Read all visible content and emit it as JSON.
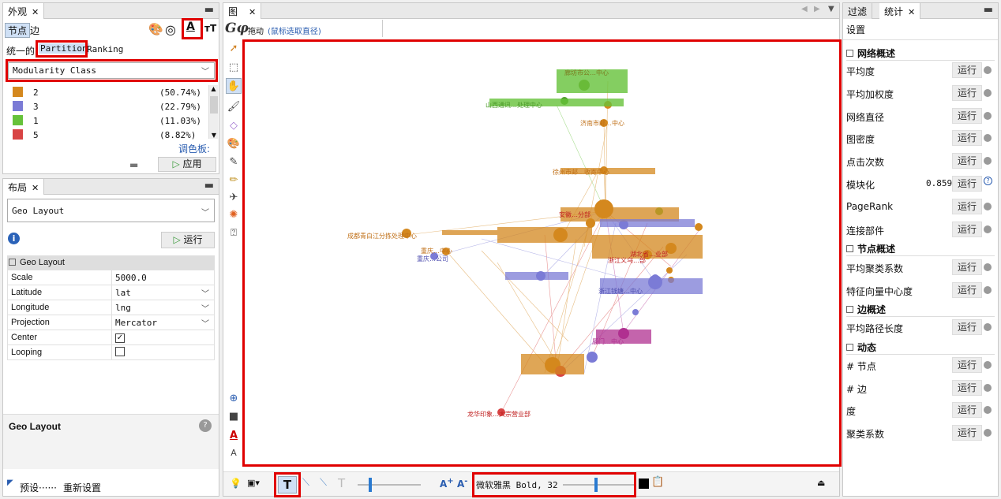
{
  "appearance": {
    "tab_title": "外观",
    "tabs": [
      "节点",
      "边"
    ],
    "mode_prefix": "统一的",
    "mode_partition": "Partition",
    "mode_ranking": "Ranking",
    "attribute": "Modularity Class",
    "legend": [
      {
        "label": "2",
        "pct": "(50.74%)",
        "color": "#d4881e"
      },
      {
        "label": "3",
        "pct": "(22.79%)",
        "color": "#7b7bd6"
      },
      {
        "label": "1",
        "pct": "(11.03%)",
        "color": "#66c23a"
      },
      {
        "label": "5",
        "pct": "(8.82%)",
        "color": "#d84444"
      }
    ],
    "palette_label": "调色板:",
    "apply_label": "应用"
  },
  "layout": {
    "tab_title": "布局",
    "algorithm": "Geo Layout",
    "run_label": "运行",
    "group_title": "Geo Layout",
    "props": [
      {
        "name": "Scale",
        "value": "5000.0",
        "type": "text"
      },
      {
        "name": "Latitude",
        "value": "lat",
        "type": "select"
      },
      {
        "name": "Longitude",
        "value": "lng",
        "type": "select"
      },
      {
        "name": "Projection",
        "value": "Mercator",
        "type": "select"
      },
      {
        "name": "Center",
        "value": "",
        "type": "checked"
      },
      {
        "name": "Looping",
        "value": "",
        "type": "unchecked"
      }
    ],
    "desc_title": "Geo Layout",
    "preset_label": "预设······",
    "reset_label": "重新设置"
  },
  "graph": {
    "tab_title": "图",
    "mode_label": "拖动",
    "mode_hint": "(鼠标选取直径)",
    "labels": [
      {
        "t": "廊坊市公…中心",
        "c": "#7b7b20"
      },
      {
        "t": "山西通讯…处理中心",
        "c": "#4c9a2a"
      },
      {
        "t": "济南市邮…中心",
        "c": "#c07018"
      },
      {
        "t": "徐州市邮…收寄中心",
        "c": "#c07018"
      },
      {
        "t": "成都青白江分拣处理中心",
        "c": "#c07018"
      },
      {
        "t": "安徽…分部",
        "c": "#c02020"
      },
      {
        "t": "湖北省…业部",
        "c": "#c02020"
      },
      {
        "t": "浙江义乌…部",
        "c": "#c02020"
      },
      {
        "t": "重庆…中心",
        "c": "#c07018"
      },
      {
        "t": "重庆…公司",
        "c": "#5050b0"
      },
      {
        "t": "浙江钱塘…中心",
        "c": "#5050b0"
      },
      {
        "t": "厦门…中心",
        "c": "#b03090"
      },
      {
        "t": "龙华印象…大宗营业部",
        "c": "#c02020"
      }
    ],
    "font_display": "微软雅黑 Bold, 32"
  },
  "stats": {
    "tabs": [
      "过滤",
      "统计"
    ],
    "settings_label": "设置",
    "run_label": "运行",
    "sections": [
      {
        "title": "网络概述",
        "items": [
          {
            "name": "平均度",
            "value": ""
          },
          {
            "name": "平均加权度",
            "value": ""
          },
          {
            "name": "网络直径",
            "value": ""
          },
          {
            "name": "图密度",
            "value": ""
          },
          {
            "name": "点击次数",
            "value": ""
          },
          {
            "name": "模块化",
            "value": "0.859"
          },
          {
            "name": "PageRank",
            "value": ""
          },
          {
            "name": "连接部件",
            "value": ""
          }
        ]
      },
      {
        "title": "节点概述",
        "items": [
          {
            "name": "平均聚类系数",
            "value": ""
          },
          {
            "name": "特征向量中心度",
            "value": ""
          }
        ]
      },
      {
        "title": "边概述",
        "items": [
          {
            "name": "平均路径长度",
            "value": ""
          }
        ]
      },
      {
        "title": "动态",
        "items": [
          {
            "name": "# 节点",
            "value": ""
          },
          {
            "name": "# 边",
            "value": ""
          },
          {
            "name": "度",
            "value": ""
          },
          {
            "name": "聚类系数",
            "value": ""
          }
        ]
      }
    ]
  }
}
